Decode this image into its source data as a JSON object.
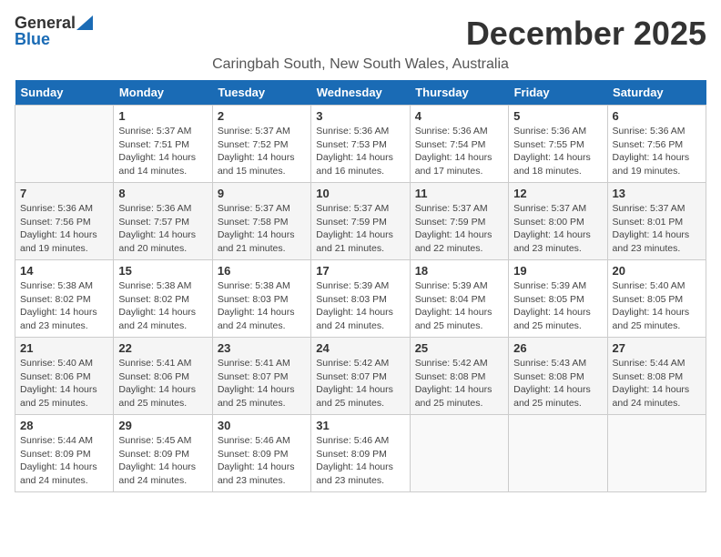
{
  "logo": {
    "general": "General",
    "blue": "Blue"
  },
  "title": "December 2025",
  "location": "Caringbah South, New South Wales, Australia",
  "days_of_week": [
    "Sunday",
    "Monday",
    "Tuesday",
    "Wednesday",
    "Thursday",
    "Friday",
    "Saturday"
  ],
  "weeks": [
    [
      {
        "day": "",
        "info": ""
      },
      {
        "day": "1",
        "info": "Sunrise: 5:37 AM\nSunset: 7:51 PM\nDaylight: 14 hours\nand 14 minutes."
      },
      {
        "day": "2",
        "info": "Sunrise: 5:37 AM\nSunset: 7:52 PM\nDaylight: 14 hours\nand 15 minutes."
      },
      {
        "day": "3",
        "info": "Sunrise: 5:36 AM\nSunset: 7:53 PM\nDaylight: 14 hours\nand 16 minutes."
      },
      {
        "day": "4",
        "info": "Sunrise: 5:36 AM\nSunset: 7:54 PM\nDaylight: 14 hours\nand 17 minutes."
      },
      {
        "day": "5",
        "info": "Sunrise: 5:36 AM\nSunset: 7:55 PM\nDaylight: 14 hours\nand 18 minutes."
      },
      {
        "day": "6",
        "info": "Sunrise: 5:36 AM\nSunset: 7:56 PM\nDaylight: 14 hours\nand 19 minutes."
      }
    ],
    [
      {
        "day": "7",
        "info": "Sunrise: 5:36 AM\nSunset: 7:56 PM\nDaylight: 14 hours\nand 19 minutes."
      },
      {
        "day": "8",
        "info": "Sunrise: 5:36 AM\nSunset: 7:57 PM\nDaylight: 14 hours\nand 20 minutes."
      },
      {
        "day": "9",
        "info": "Sunrise: 5:37 AM\nSunset: 7:58 PM\nDaylight: 14 hours\nand 21 minutes."
      },
      {
        "day": "10",
        "info": "Sunrise: 5:37 AM\nSunset: 7:59 PM\nDaylight: 14 hours\nand 21 minutes."
      },
      {
        "day": "11",
        "info": "Sunrise: 5:37 AM\nSunset: 7:59 PM\nDaylight: 14 hours\nand 22 minutes."
      },
      {
        "day": "12",
        "info": "Sunrise: 5:37 AM\nSunset: 8:00 PM\nDaylight: 14 hours\nand 23 minutes."
      },
      {
        "day": "13",
        "info": "Sunrise: 5:37 AM\nSunset: 8:01 PM\nDaylight: 14 hours\nand 23 minutes."
      }
    ],
    [
      {
        "day": "14",
        "info": "Sunrise: 5:38 AM\nSunset: 8:02 PM\nDaylight: 14 hours\nand 23 minutes."
      },
      {
        "day": "15",
        "info": "Sunrise: 5:38 AM\nSunset: 8:02 PM\nDaylight: 14 hours\nand 24 minutes."
      },
      {
        "day": "16",
        "info": "Sunrise: 5:38 AM\nSunset: 8:03 PM\nDaylight: 14 hours\nand 24 minutes."
      },
      {
        "day": "17",
        "info": "Sunrise: 5:39 AM\nSunset: 8:03 PM\nDaylight: 14 hours\nand 24 minutes."
      },
      {
        "day": "18",
        "info": "Sunrise: 5:39 AM\nSunset: 8:04 PM\nDaylight: 14 hours\nand 25 minutes."
      },
      {
        "day": "19",
        "info": "Sunrise: 5:39 AM\nSunset: 8:05 PM\nDaylight: 14 hours\nand 25 minutes."
      },
      {
        "day": "20",
        "info": "Sunrise: 5:40 AM\nSunset: 8:05 PM\nDaylight: 14 hours\nand 25 minutes."
      }
    ],
    [
      {
        "day": "21",
        "info": "Sunrise: 5:40 AM\nSunset: 8:06 PM\nDaylight: 14 hours\nand 25 minutes."
      },
      {
        "day": "22",
        "info": "Sunrise: 5:41 AM\nSunset: 8:06 PM\nDaylight: 14 hours\nand 25 minutes."
      },
      {
        "day": "23",
        "info": "Sunrise: 5:41 AM\nSunset: 8:07 PM\nDaylight: 14 hours\nand 25 minutes."
      },
      {
        "day": "24",
        "info": "Sunrise: 5:42 AM\nSunset: 8:07 PM\nDaylight: 14 hours\nand 25 minutes."
      },
      {
        "day": "25",
        "info": "Sunrise: 5:42 AM\nSunset: 8:08 PM\nDaylight: 14 hours\nand 25 minutes."
      },
      {
        "day": "26",
        "info": "Sunrise: 5:43 AM\nSunset: 8:08 PM\nDaylight: 14 hours\nand 25 minutes."
      },
      {
        "day": "27",
        "info": "Sunrise: 5:44 AM\nSunset: 8:08 PM\nDaylight: 14 hours\nand 24 minutes."
      }
    ],
    [
      {
        "day": "28",
        "info": "Sunrise: 5:44 AM\nSunset: 8:09 PM\nDaylight: 14 hours\nand 24 minutes."
      },
      {
        "day": "29",
        "info": "Sunrise: 5:45 AM\nSunset: 8:09 PM\nDaylight: 14 hours\nand 24 minutes."
      },
      {
        "day": "30",
        "info": "Sunrise: 5:46 AM\nSunset: 8:09 PM\nDaylight: 14 hours\nand 23 minutes."
      },
      {
        "day": "31",
        "info": "Sunrise: 5:46 AM\nSunset: 8:09 PM\nDaylight: 14 hours\nand 23 minutes."
      },
      {
        "day": "",
        "info": ""
      },
      {
        "day": "",
        "info": ""
      },
      {
        "day": "",
        "info": ""
      }
    ]
  ]
}
